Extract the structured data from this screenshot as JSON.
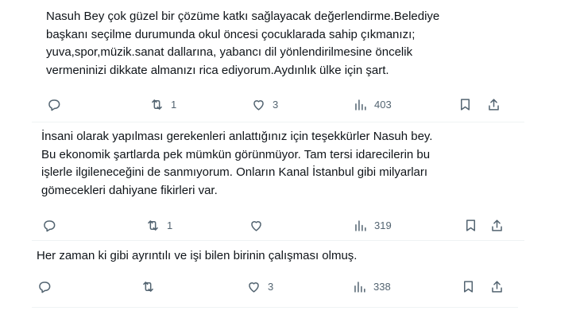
{
  "posts": [
    {
      "text_lines": [
        "Nasuh Bey çok güzel bir çözüme katkı sağlayacak değerlendirme.Belediye",
        "başkanı seçilme durumunda okul öncesi çocuklarada sahip çıkmanızı;",
        "yuva,spor,müzik.sanat dallarına, yabancı dil yönlendirilmesine öncelik",
        "vermeninizi dikkate almanızı rica ediyorum.Aydınlık ülke için şart."
      ],
      "reply_count": "",
      "retweet_count": "1",
      "like_count": "3",
      "view_count": "403"
    },
    {
      "text_lines": [
        "İnsani olarak yapılması gerekenleri anlattığınız için teşekkürler Nasuh bey.",
        "Bu ekonomik şartlarda pek mümkün görünmüyor. Tam tersi idarecilerin bu",
        "işlerle ilgileneceğini de sanmıyorum. Onların Kanal İstanbul gibi milyarları",
        "gömecekleri dahiyane fikirleri var."
      ],
      "reply_count": "",
      "retweet_count": "1",
      "like_count": "",
      "view_count": "319"
    },
    {
      "text_lines": [
        "Her zaman ki gibi ayrıntılı ve işi bilen birinin çalışması olmuş."
      ],
      "reply_count": "",
      "retweet_count": "",
      "like_count": "3",
      "view_count": "338"
    }
  ],
  "icons": {
    "reply": "reply-icon",
    "retweet": "retweet-icon",
    "like": "heart-icon",
    "views": "views-icon",
    "bookmark": "bookmark-icon",
    "share": "share-icon"
  },
  "colors": {
    "text": "#0f1419",
    "icon": "#536471",
    "divider": "#eff3f4"
  }
}
